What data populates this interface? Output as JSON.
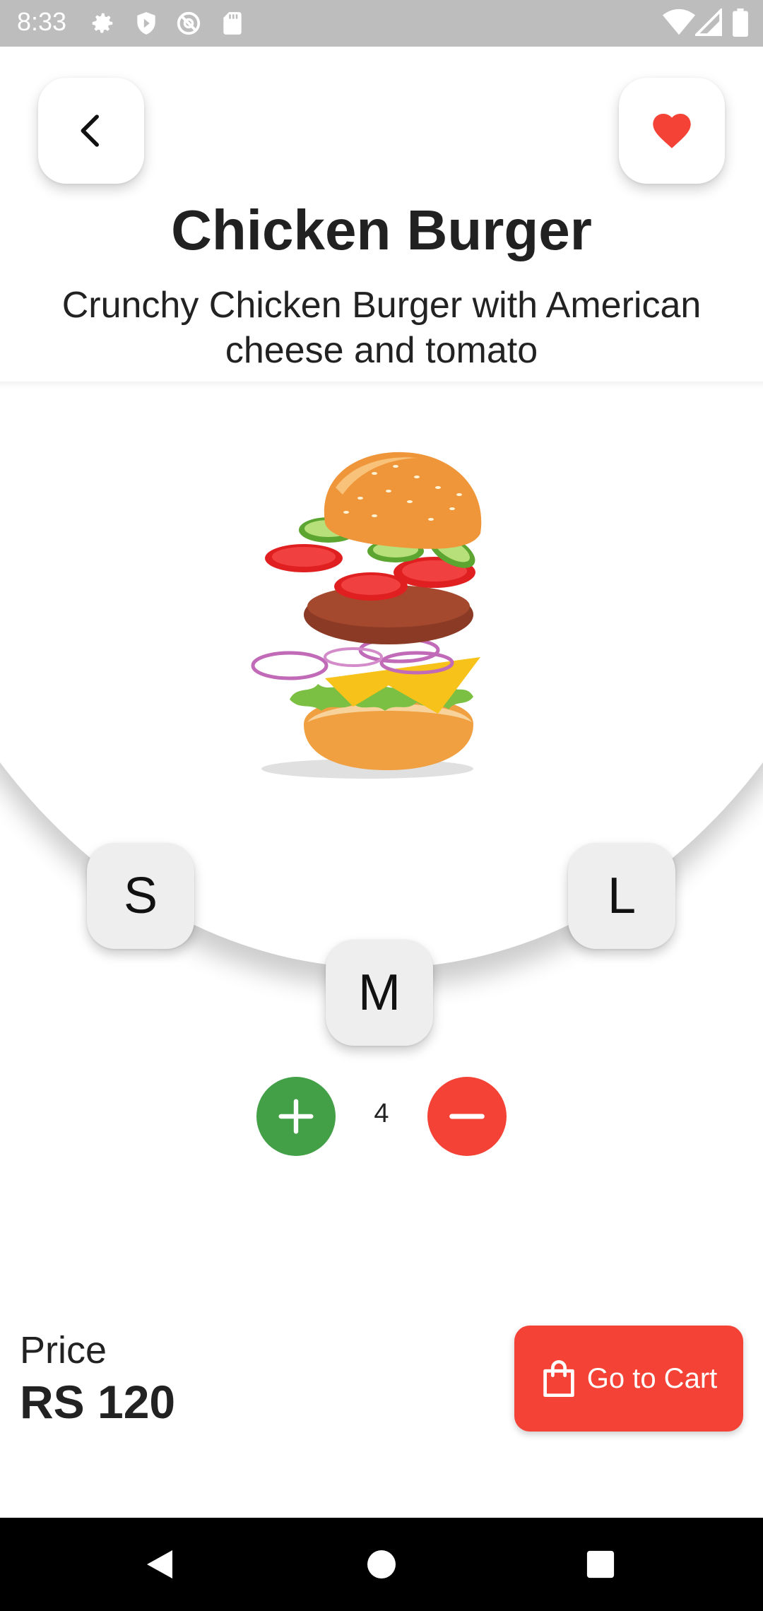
{
  "status_bar": {
    "time": "8:33",
    "left_icons": [
      "settings-icon",
      "shield-icon",
      "at-sign-icon",
      "sd-card-icon"
    ],
    "right_icons": [
      "wifi-icon",
      "cellular-signal-icon",
      "battery-icon"
    ],
    "background": "#bdbdbd"
  },
  "header": {
    "back_icon": "chevron-left-icon",
    "favorite_icon": "heart-icon",
    "favorite_color": "#f44336"
  },
  "product": {
    "name": "Chicken Burger",
    "description": "Crunchy Chicken Burger with American cheese and tomato",
    "image": "burger-illustration"
  },
  "sizes": {
    "options": [
      "S",
      "M",
      "L"
    ]
  },
  "quantity": {
    "value": "4",
    "increase_icon": "plus-icon",
    "decrease_icon": "minus-icon",
    "increase_color": "#43a047",
    "decrease_color": "#f44336"
  },
  "footer": {
    "price_label": "Price",
    "price_value": "RS 120",
    "cart_button_label": "Go to Cart",
    "cart_icon": "shopping-bag-icon",
    "accent": "#f44336"
  },
  "nav_bar": {
    "items": [
      "back-triangle-icon",
      "home-circle-icon",
      "recents-square-icon"
    ]
  }
}
